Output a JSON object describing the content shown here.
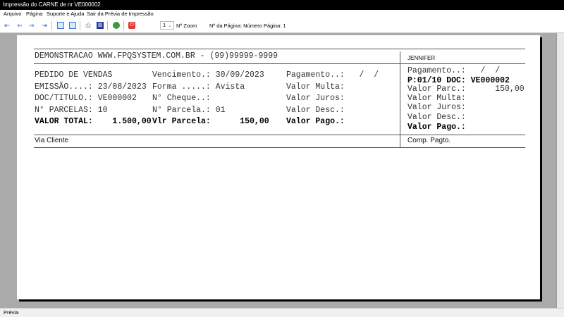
{
  "window": {
    "title": "Impressão do CARNE de nr VE000002"
  },
  "menu": [
    "Arquivo",
    "Página",
    "Suporte e Ajuda",
    "Sair da Prévia de Impressão"
  ],
  "toolbar": {
    "zoom_value": "1",
    "zoom_label": "Nº Zoom",
    "page_label": "Nº da Página: Número Página: 1",
    "icons": [
      "first-page-icon",
      "prev-page-icon",
      "next-page-icon",
      "last-page-icon",
      "single-page-icon",
      "two-page-icon",
      "print-icon",
      "save-icon",
      "export-icon",
      "close-icon"
    ]
  },
  "document": {
    "header": "DEMONSTRACAO WWW.FPQSYSTEM.COM.BR - (99)99999-9999",
    "client_name": "JENNIFER",
    "left_col1": [
      "PEDIDO DE VENDAS",
      "EMISSÃO....: 23/08/2023",
      "DOC/TITULO.: VE000002",
      "N° PARCELAS: 10",
      "VALOR TOTAL:    1.500,00"
    ],
    "left_col2": [
      "Vencimento.: 30/09/2023",
      "Forma .....: Avista",
      "N° Cheque..:",
      "N° Parcela.: 01",
      "Vlr Parcela:      150,00"
    ],
    "left_col3": [
      "Pagamento..:   /  /",
      "Valor Multa:",
      "Valor Juros:",
      "Valor Desc.:",
      "Valor Pago.:"
    ],
    "right_col": [
      "Pagamento..:   /  /",
      "P:01/10 DOC: VE000002",
      "Valor Parc.:      150,00",
      "Valor Multa:",
      "Valor Juros:",
      "Valor Desc.:",
      "Valor Pago.:"
    ],
    "footer_left": "Via Cliente",
    "footer_right": "Comp. Pagto."
  },
  "status": "Prévia"
}
